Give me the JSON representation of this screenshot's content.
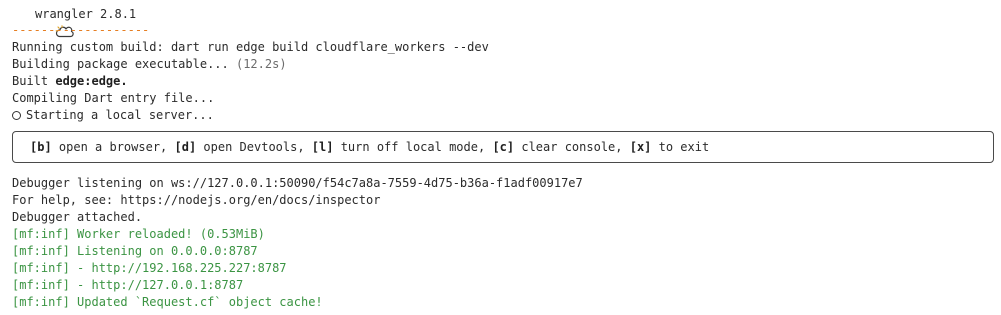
{
  "cut_top_line": {
    "left": "                                 ",
    "orange": "                  "
  },
  "header": {
    "icon": "cloud-sun-icon",
    "title": "wrangler 2.8.1"
  },
  "divider": "-------------------",
  "build": {
    "custom_build": "Running custom build: dart run edge build cloudflare_workers --dev",
    "building_prefix": "Building package executable... ",
    "building_time": "(12.2s)",
    "built_prefix": "Built ",
    "built_target": "edge:edge.",
    "compiling": "Compiling Dart entry file...",
    "starting": "Starting a local server..."
  },
  "shortcuts": {
    "items": [
      {
        "key": "[b]",
        "label": " open a browser, "
      },
      {
        "key": "[d]",
        "label": " open Devtools, "
      },
      {
        "key": "[l]",
        "label": " turn off local mode, "
      },
      {
        "key": "[c]",
        "label": " clear console, "
      },
      {
        "key": "[x]",
        "label": " to exit"
      }
    ]
  },
  "debugger": {
    "listening": "Debugger listening on ws://127.0.0.1:50090/f54c7a8a-7559-4d75-b36a-f1adf00917e7",
    "help": "For help, see: https://nodejs.org/en/docs/inspector",
    "attached": "Debugger attached."
  },
  "miniflare": [
    "[mf:inf] Worker reloaded! (0.53MiB)",
    "[mf:inf] Listening on 0.0.0.0:8787",
    "[mf:inf] - http://192.168.225.227:8787",
    "[mf:inf] - http://127.0.0.1:8787",
    "[mf:inf] Updated `Request.cf` object cache!"
  ],
  "colors": {
    "divider": "#e67e22",
    "info_green": "#3b9443",
    "muted": "#6b6b6b",
    "text": "#2b2b2b"
  }
}
